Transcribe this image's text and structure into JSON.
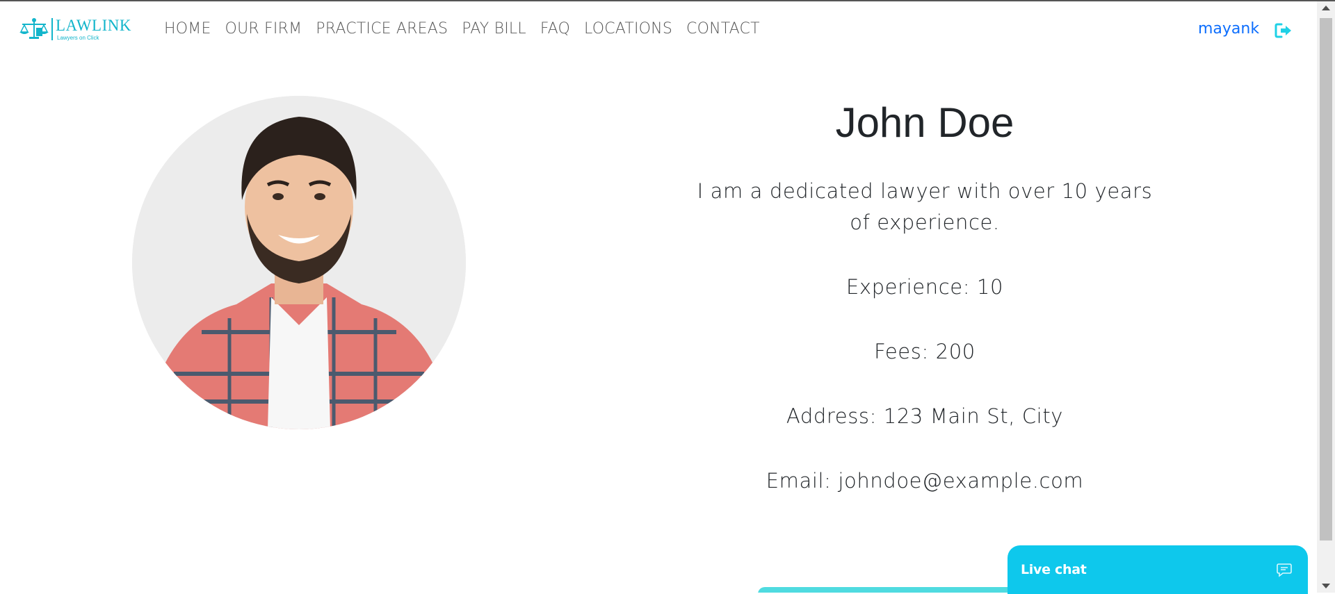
{
  "brand": {
    "name": "LAWLINK",
    "tagline": "Lawyers on Click",
    "color": "#12b5cb"
  },
  "nav": {
    "links": [
      {
        "label": "HOME"
      },
      {
        "label": "OUR FIRM"
      },
      {
        "label": "PRACTICE AREAS"
      },
      {
        "label": "PAY BILL"
      },
      {
        "label": "FAQ"
      },
      {
        "label": "LOCATIONS"
      },
      {
        "label": "CONTACT"
      }
    ],
    "user": "mayank",
    "logout_icon": "sign-out-icon"
  },
  "profile": {
    "name": "John Doe",
    "bio": "I am a dedicated lawyer with over 10 years of experience.",
    "experience": "Experience: 10",
    "fees": "Fees: 200",
    "address": "Address: 123 Main St, City",
    "email": "Email: johndoe@example.com"
  },
  "live_chat": {
    "label": "Live chat",
    "icon": "chat-bubble-icon",
    "color": "#0ec8ec"
  }
}
